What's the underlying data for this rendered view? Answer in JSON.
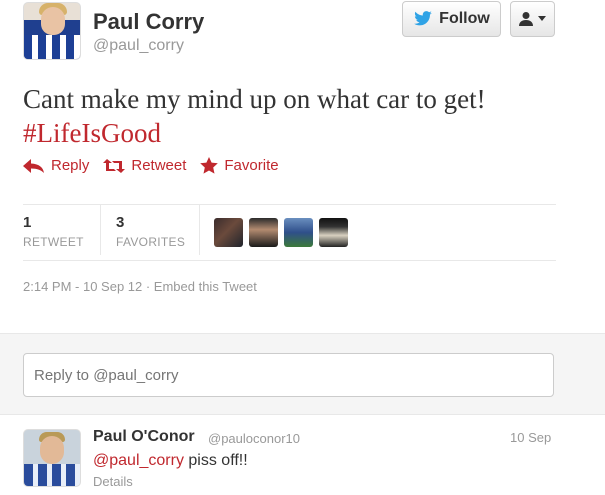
{
  "author": {
    "name": "Paul Corry",
    "handle": "@paul_corry"
  },
  "buttons": {
    "follow_label": "Follow"
  },
  "tweet": {
    "text": "Cant make my mind up on what car to get!",
    "hashtag": "#LifeIsGood"
  },
  "actions": {
    "reply": "Reply",
    "retweet": "Retweet",
    "favorite": "Favorite"
  },
  "stats": {
    "retweets": {
      "count": "1",
      "label": "RETWEET"
    },
    "favorites": {
      "count": "3",
      "label": "FAVORITES"
    }
  },
  "meta": {
    "timestamp": "2:14 PM - 10 Sep 12 · Embed this Tweet"
  },
  "reply_box": {
    "placeholder": "Reply to @paul_corry"
  },
  "reply": {
    "name": "Paul O'Conor",
    "handle": "@pauloconor10",
    "date": "10 Sep",
    "mention": "@paul_corry",
    "text": " piss off!!",
    "details": "Details"
  },
  "colors": {
    "accent": "#c0282e",
    "muted": "#999999",
    "follow_bird": "#2fa3e6"
  },
  "icons": {
    "reply": "reply-arrow-icon",
    "retweet": "retweet-icon",
    "favorite": "star-icon",
    "follow": "twitter-bird-icon",
    "user_menu": "user-dropdown-icon"
  }
}
